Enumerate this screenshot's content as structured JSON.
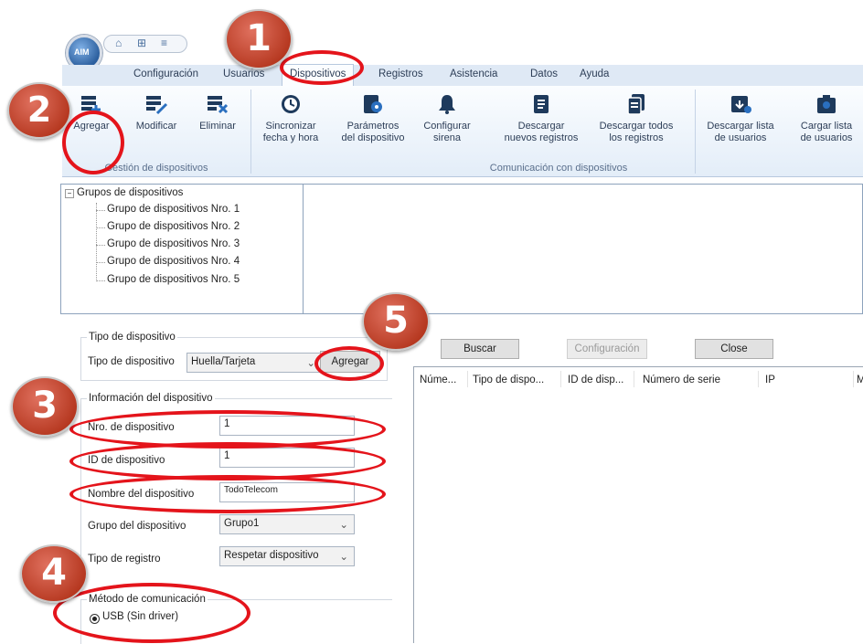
{
  "tabs": [
    "Configuración",
    "Usuarios",
    "Dispositivos",
    "Registros",
    "Asistencia",
    "Datos",
    "Ayuda"
  ],
  "active_tab": "Dispositivos",
  "ribbon": {
    "group1_label": "Gestión de dispositivos",
    "group2_label": "Comunicación con dispositivos",
    "buttons": [
      {
        "label": "Agregar",
        "icon": "add-device-icon"
      },
      {
        "label": "Modificar",
        "icon": "edit-device-icon"
      },
      {
        "label": "Eliminar",
        "icon": "delete-device-icon"
      },
      {
        "label": "Sincronizar\nfecha y hora",
        "icon": "clock-icon"
      },
      {
        "label": "Parámetros\ndel dispositivo",
        "icon": "device-settings-icon"
      },
      {
        "label": "Configurar\nsirena",
        "icon": "bell-icon"
      },
      {
        "label": "Descargar\nnuevos registros",
        "icon": "download-record-icon"
      },
      {
        "label": "Descargar todos\nlos registros",
        "icon": "download-all-icon"
      },
      {
        "label": "Descargar lista\nde usuarios",
        "icon": "download-users-icon"
      },
      {
        "label": "Cargar lista\nde usuarios",
        "icon": "upload-users-icon"
      }
    ]
  },
  "tree": {
    "root": "Grupos de dispositivos",
    "items": [
      "Grupo de dispositivos Nro. 1",
      "Grupo de dispositivos Nro. 2",
      "Grupo de dispositivos Nro. 3",
      "Grupo de dispositivos Nro. 4",
      "Grupo de dispositivos Nro. 5"
    ]
  },
  "form": {
    "type_legend": "Tipo de dispositivo",
    "type_label": "Tipo de dispositivo",
    "type_value": "Huella/Tarjeta",
    "add_button": "Agregar",
    "info_legend": "Información del dispositivo",
    "nro_label": "Nro. de dispositivo",
    "nro_value": "1",
    "id_label": "ID de dispositivo",
    "id_value": "1",
    "name_label": "Nombre del dispositivo",
    "name_value": "TodoTelecom",
    "group_label": "Grupo del dispositivo",
    "group_value": "Grupo1",
    "reg_label": "Tipo de registro",
    "reg_value": "Respetar dispositivo",
    "comm_legend": "Método de comunicación",
    "comm_option": "USB (Sin driver)"
  },
  "search_bar": {
    "search": "Buscar",
    "config": "Configuración",
    "close": "Close"
  },
  "table_columns": [
    "Núme...",
    "Tipo de dispo...",
    "ID de disp...",
    "Número de serie",
    "IP",
    "M"
  ],
  "badges": [
    "1",
    "2",
    "3",
    "4",
    "5"
  ],
  "colors": {
    "annotation_red": "#e4141b",
    "badge": "#c0432c",
    "ribbon": "#dfe9f5"
  }
}
